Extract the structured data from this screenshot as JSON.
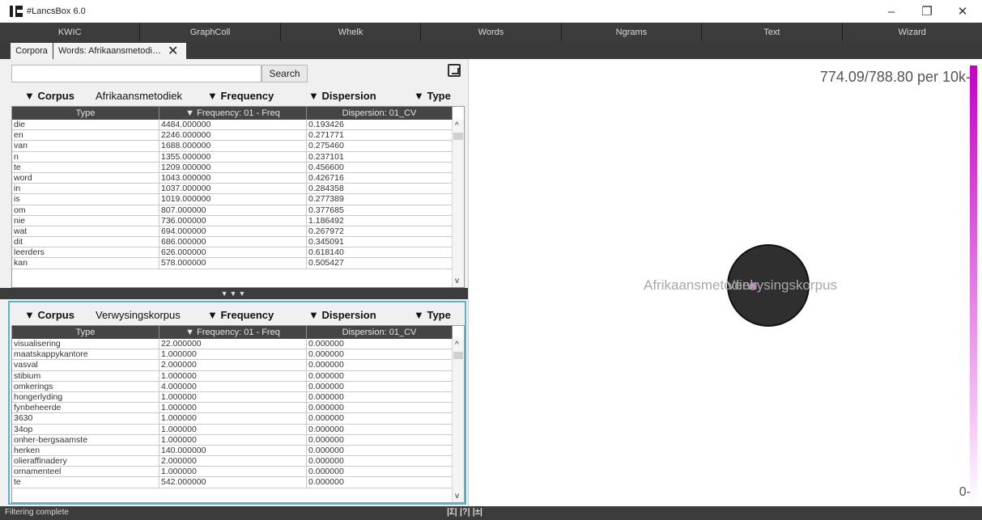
{
  "app": {
    "title": "#LancsBox 6.0"
  },
  "window_controls": {
    "minimize": "–",
    "maximize": "❐",
    "close": "✕"
  },
  "modules": [
    "KWIC",
    "GraphColl",
    "Whelk",
    "Words",
    "Ngrams",
    "Text",
    "Wizard"
  ],
  "doc_tabs": {
    "corpora": "Corpora",
    "words": "Words: Afrikaansmetodi…",
    "close": "✕"
  },
  "search": {
    "value": "",
    "button": "Search"
  },
  "upper": {
    "filter": {
      "corpus_label": "▼ Corpus",
      "corpus_value": "Afrikaansmetodiek",
      "frequency": "▼ Frequency",
      "dispersion": "▼ Dispersion",
      "type": "▼ Type"
    },
    "columns": [
      "Type",
      "▼ Frequency: 01 - Freq",
      "Dispersion: 01_CV"
    ],
    "rows": [
      [
        "die",
        "4484.000000",
        "0.193426"
      ],
      [
        "en",
        "2246.000000",
        "0.271771"
      ],
      [
        "van",
        "1688.000000",
        "0.275460"
      ],
      [
        "n",
        "1355.000000",
        "0.237101"
      ],
      [
        "te",
        "1209.000000",
        "0.456600"
      ],
      [
        "word",
        "1043.000000",
        "0.426716"
      ],
      [
        "in",
        "1037.000000",
        "0.284358"
      ],
      [
        "is",
        "1019.000000",
        "0.277389"
      ],
      [
        "om",
        "807.000000",
        "0.377685"
      ],
      [
        "nie",
        "736.000000",
        "1.186492"
      ],
      [
        "wat",
        "694.000000",
        "0.267972"
      ],
      [
        "dit",
        "686.000000",
        "0.345091"
      ],
      [
        "leerders",
        "626.000000",
        "0.618140"
      ],
      [
        "kan",
        "578.000000",
        "0.505427"
      ]
    ]
  },
  "divider": "▼▼▼",
  "lower": {
    "filter": {
      "corpus_label": "▼ Corpus",
      "corpus_value": "Verwysingskorpus",
      "frequency": "▼ Frequency",
      "dispersion": "▼ Dispersion",
      "type": "▼ Type"
    },
    "columns": [
      "Type",
      "▼ Frequency: 01 - Freq",
      "Dispersion: 01_CV"
    ],
    "rows": [
      [
        "visualisering",
        "22.000000",
        "0.000000"
      ],
      [
        "maatskappykantore",
        "1.000000",
        "0.000000"
      ],
      [
        "vasval",
        "2.000000",
        "0.000000"
      ],
      [
        "stibium",
        "1.000000",
        "0.000000"
      ],
      [
        "omkerings",
        "4.000000",
        "0.000000"
      ],
      [
        "hongerlyding",
        "1.000000",
        "0.000000"
      ],
      [
        "fynbeheerde",
        "1.000000",
        "0.000000"
      ],
      [
        "3630",
        "1.000000",
        "0.000000"
      ],
      [
        "34op",
        "1.000000",
        "0.000000"
      ],
      [
        "onher-bergsaamste",
        "1.000000",
        "0.000000"
      ],
      [
        "herken",
        "140.000000",
        "0.000000"
      ],
      [
        "olieraffinadery",
        "2.000000",
        "0.000000"
      ],
      [
        "ornamenteel",
        "1.000000",
        "0.000000"
      ],
      [
        "te",
        "542.000000",
        "0.000000"
      ]
    ]
  },
  "viz": {
    "scale_top": "774.09/788.80 per 10k-",
    "scale_bottom": "0-",
    "label_left": "Afrikaansmetodiek",
    "label_right": "Verwysingskorpus"
  },
  "status": {
    "text": "Filtering complete",
    "icons": "|Σ| |?| |±|"
  },
  "colors": {
    "accent_magenta": "#c600c6",
    "frame_blue": "#55b3cc",
    "dark_bar": "#3c3c3c"
  }
}
